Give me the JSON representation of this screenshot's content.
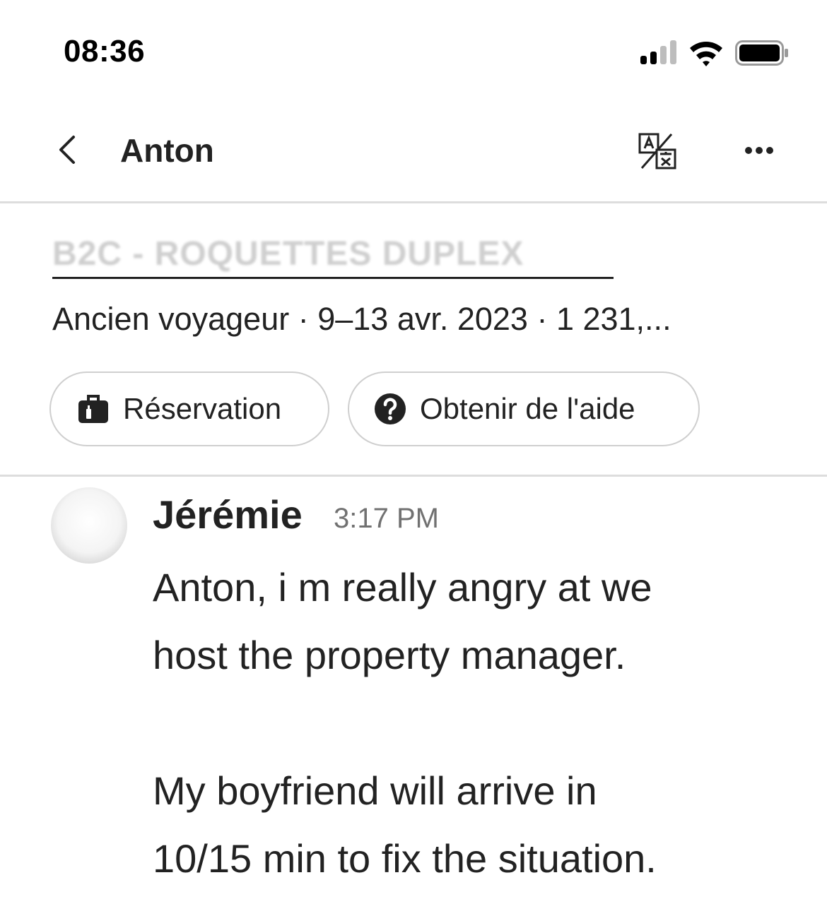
{
  "status_bar": {
    "time": "08:36"
  },
  "header": {
    "title": "Anton"
  },
  "listing": {
    "name": "B2C - ROQUETTES DUPLEX",
    "meta": "Ancien voyageur · 9–13 avr. 2023 · 1 231,..."
  },
  "actions": {
    "reservation_label": "Réservation",
    "help_label": "Obtenir de l'aide"
  },
  "message": {
    "sender": "Jérémie",
    "time": "3:17 PM",
    "lines": [
      "Anton, i m really angry at we",
      "host the property manager.",
      "My boyfriend will arrive in",
      "10/15 min to fix the situation."
    ]
  },
  "icons": {
    "back": "chevron-left-icon",
    "translate": "translate-icon",
    "more": "more-horizontal-icon",
    "reservation": "suitcase-icon",
    "help": "question-circle-icon"
  },
  "colors": {
    "text": "#222222",
    "muted": "#717171",
    "divider": "#dddddd",
    "background": "#ffffff"
  }
}
